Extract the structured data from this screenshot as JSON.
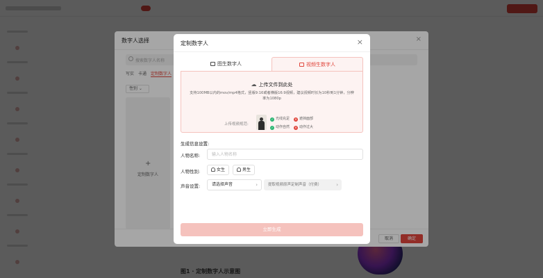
{
  "colors": {
    "accent": "#e0463c",
    "accent_light": "#fdf3f2",
    "accent_border": "#f5c2bd"
  },
  "background": {
    "bottom_caption": "图1 · 定制数字人示意图"
  },
  "picker_dialog": {
    "title": "数字人选择",
    "close_icon": "close-icon",
    "search_placeholder": "搜索数字人名称",
    "tabs": [
      "写实",
      "卡通",
      "定制数字人"
    ],
    "filter_label": "性别",
    "create_card_label": "定制数字人",
    "create_card_icon": "+",
    "cancel_label": "取消",
    "confirm_label": "确定"
  },
  "custom_dialog": {
    "title": "定制数字人",
    "close_glyph": "×",
    "tabs": {
      "image": "图生数字人",
      "video": "视频生数字人"
    },
    "upload": {
      "title": "上传文件到此处",
      "description": "支持100MB以内的mov/mp4格式，竖版9:16或者横版16:9视频，建议视频时长为10秒到1分钟，分辨率为1080p",
      "example_label": "上传视频规范:",
      "checks": [
        {
          "text": "光线充足",
          "ok": true
        },
        {
          "text": "动作自然",
          "ok": true
        },
        {
          "text": "遮挡面部",
          "ok": false
        },
        {
          "text": "动作过大",
          "ok": false
        }
      ]
    },
    "section_title": "生成信息设置:",
    "name_label": "人物名称:",
    "name_placeholder": "输入人物名称",
    "gender_label": "人物性别:",
    "gender_options": [
      "女生",
      "男生"
    ],
    "voice_label": "声音设置:",
    "voice_select": "请选择声音",
    "extract_voice": "提取视频原声定制声音（付费）",
    "submit_label": "立即生成"
  }
}
